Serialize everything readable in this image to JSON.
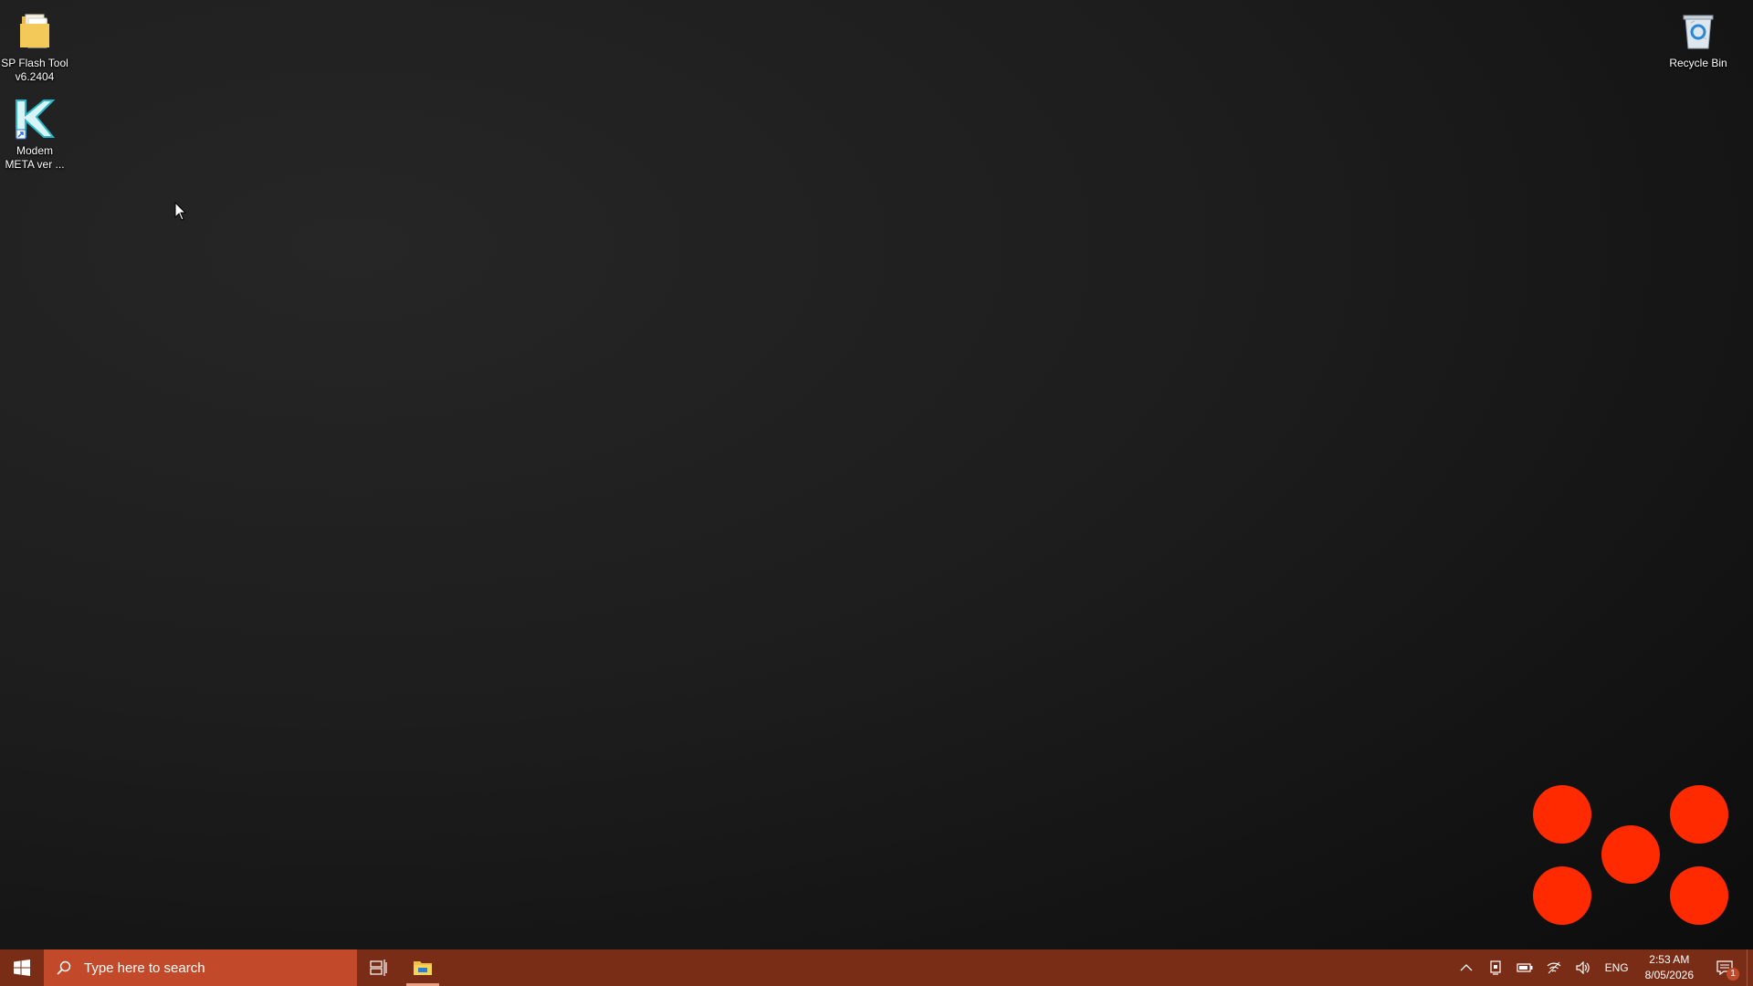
{
  "desktop": {
    "icons": [
      {
        "label": "SP Flash Tool\nv6.2404",
        "icon": "folder-icon"
      },
      {
        "label": "Modem\nMETA ver ...",
        "icon": "modem-meta-app-icon"
      },
      {
        "label": "Recycle Bin",
        "icon": "recycle-bin-icon"
      }
    ],
    "decoration_color": "#ff2a00"
  },
  "taskbar": {
    "background": "#7a2d16",
    "search": {
      "placeholder": "Type here to search"
    },
    "pinned": [
      {
        "name": "task-view",
        "icon": "task-view-icon"
      },
      {
        "name": "file-explorer",
        "icon": "file-explorer-icon",
        "active": true
      }
    ],
    "tray": {
      "language": "ENG",
      "time": "2:53 AM",
      "date": "8/05/2026",
      "notification_count": "1"
    }
  }
}
